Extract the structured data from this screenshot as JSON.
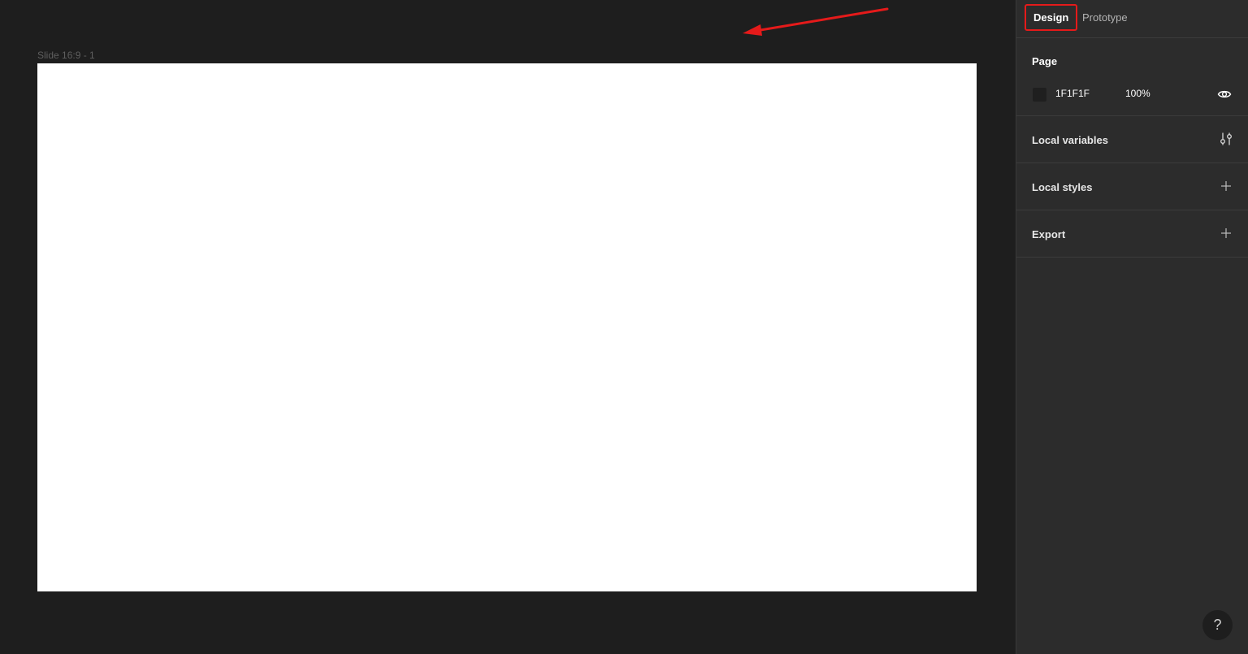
{
  "canvas": {
    "frame_label": "Slide 16:9 - 1"
  },
  "panel": {
    "tabs": [
      {
        "label": "Design",
        "active": true
      },
      {
        "label": "Prototype",
        "active": false
      }
    ],
    "page": {
      "title": "Page",
      "fill_hex": "1F1F1F",
      "fill_opacity": "100%",
      "visibility_icon": "eye-icon"
    },
    "local_variables": {
      "title": "Local variables",
      "action_icon": "variables-sliders-icon"
    },
    "local_styles": {
      "title": "Local styles",
      "action_icon": "plus-icon"
    },
    "export": {
      "title": "Export",
      "action_icon": "plus-icon"
    },
    "help_label": "?"
  },
  "colors": {
    "canvas_bg": "#1e1e1e",
    "panel_bg": "#2c2c2c",
    "annotation_red": "#e51a1a",
    "page_fill": "#1F1F1F"
  }
}
